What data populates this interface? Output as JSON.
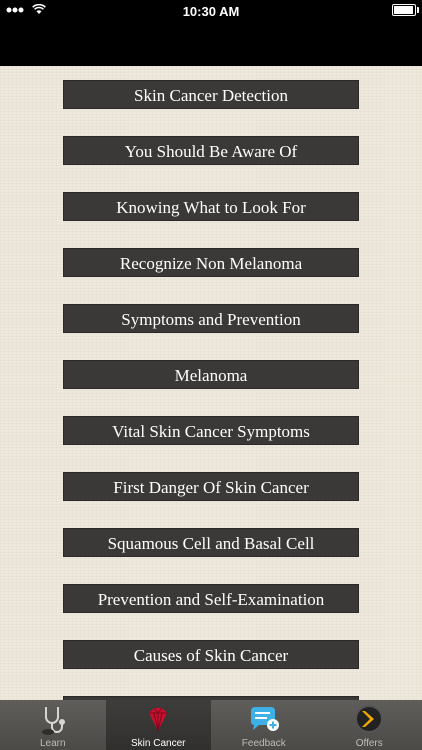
{
  "status_bar": {
    "time": "10:30 AM",
    "signal_icon": "signal-dots-icon",
    "wifi_icon": "wifi-icon",
    "battery_icon": "battery-icon",
    "battery_level": 0.95
  },
  "menu": {
    "items": [
      "Skin Cancer Detection",
      "You Should Be Aware Of",
      "Knowing What to Look For",
      "Recognize Non Melanoma",
      "Symptoms and Prevention",
      "Melanoma",
      "Vital Skin Cancer Symptoms",
      "First Danger Of Skin Cancer",
      "Squamous Cell and Basal Cell",
      "Prevention and Self-Examination",
      "Causes of Skin Cancer",
      ""
    ]
  },
  "tab_bar": {
    "tabs": [
      {
        "label": "Learn",
        "icon": "stethoscope-icon",
        "active": false
      },
      {
        "label": "Skin Cancer",
        "icon": "gem-icon",
        "active": true,
        "icon_color": "#c8102e"
      },
      {
        "label": "Feedback",
        "icon": "chat-bubble-icon",
        "active": false,
        "icon_color": "#3fb0e6"
      },
      {
        "label": "Offers",
        "icon": "chevron-right-icon",
        "active": false,
        "icon_color": "#f2a900"
      }
    ]
  }
}
